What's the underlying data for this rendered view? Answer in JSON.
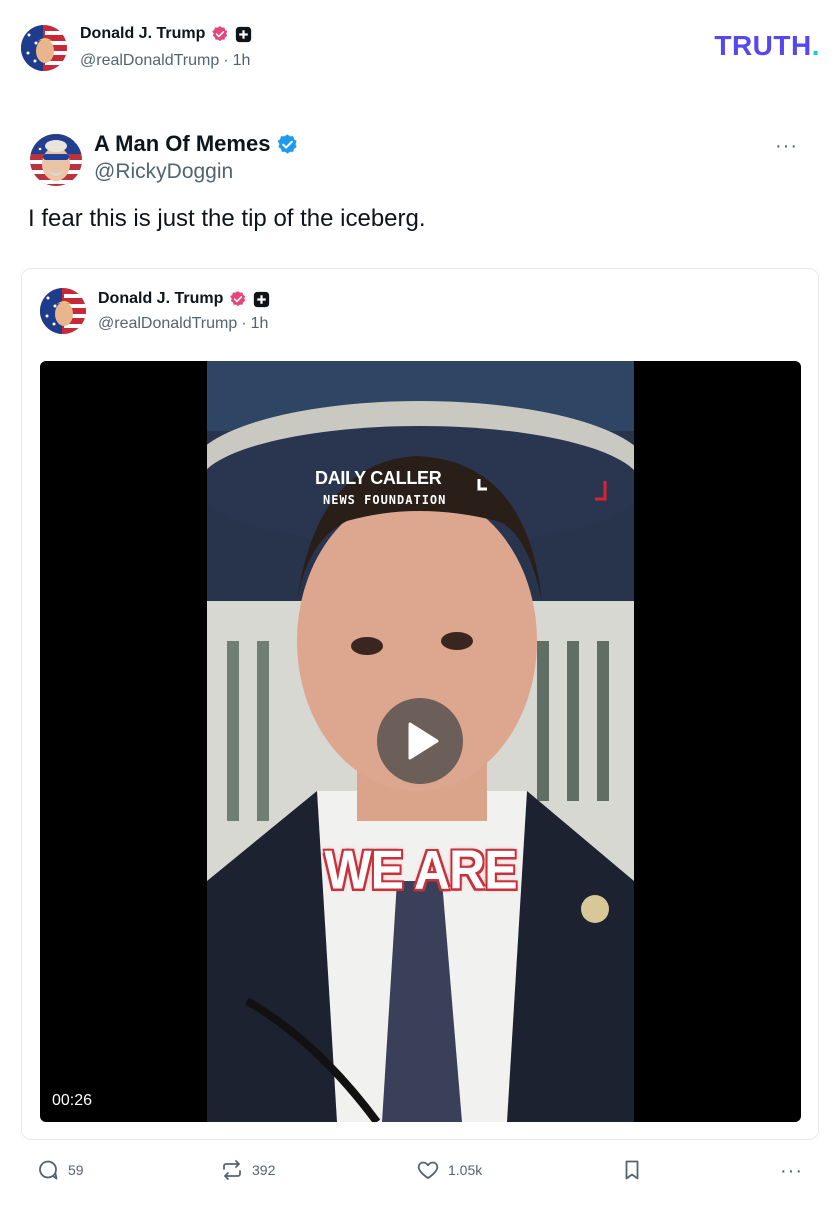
{
  "header": {
    "name": "Donald J. Trump",
    "handle": "@realDonaldTrump",
    "separator": "·",
    "time": "1h",
    "logo_text": "TRUTH",
    "logo_dot": "."
  },
  "post": {
    "author_name": "A Man Of Memes",
    "author_handle": "@RickyDoggin",
    "text": "I fear this is just the tip of the iceberg.",
    "more": "···"
  },
  "quote": {
    "name": "Donald J. Trump",
    "handle": "@realDonaldTrump",
    "separator": "·",
    "time": "1h",
    "video": {
      "duration": "00:26",
      "caption": "WE ARE",
      "brand_main": "DAILY CALLER",
      "brand_sub": "NEWS FOUNDATION"
    }
  },
  "actions": {
    "replies": "59",
    "retruths": "392",
    "likes": "1.05k",
    "more": "···"
  },
  "colors": {
    "brand": "#5448ee",
    "brand_dot": "#14d2b4",
    "verified_blue": "#1d9bf0",
    "badge_pink": "#e5457a",
    "text_secondary": "#536471"
  },
  "icons": [
    "verified-icon",
    "plus-badge-icon",
    "reply-icon",
    "retruth-icon",
    "like-icon",
    "bookmark-icon",
    "more-icon",
    "play-icon"
  ]
}
